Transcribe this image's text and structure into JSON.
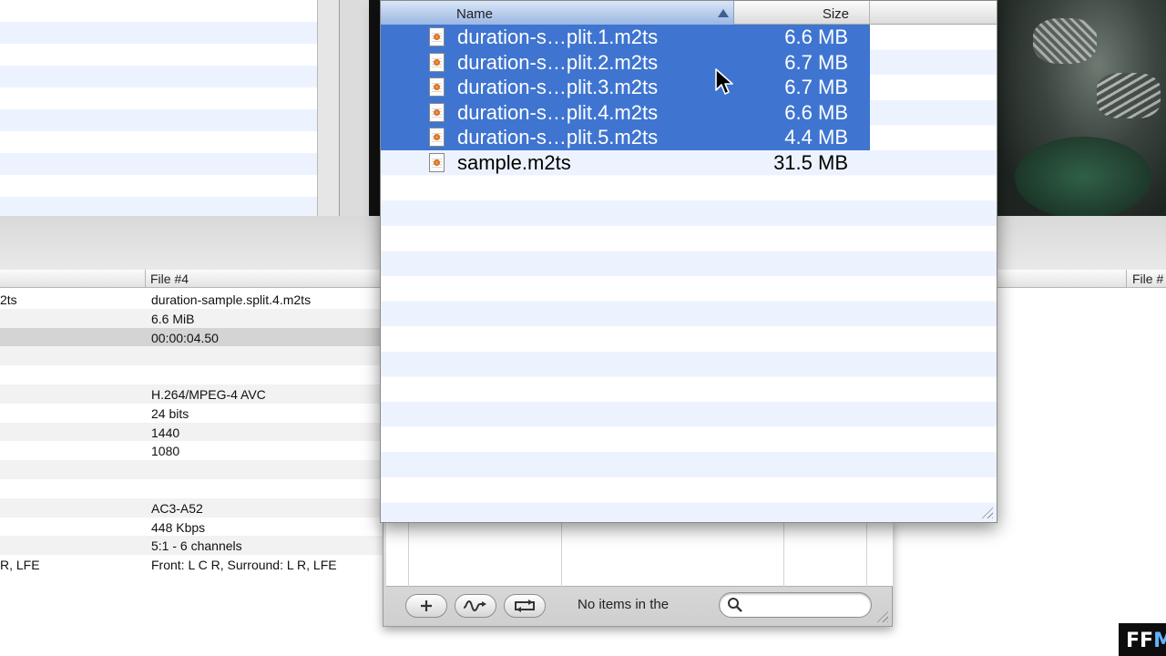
{
  "file_window": {
    "columns": {
      "name": "Name",
      "size": "Size"
    },
    "sort": "ascending",
    "files": [
      {
        "name": "duration-s…plit.1.m2ts",
        "size": "6.6 MB",
        "selected": true
      },
      {
        "name": "duration-s…plit.2.m2ts",
        "size": "6.7 MB",
        "selected": true
      },
      {
        "name": "duration-s…plit.3.m2ts",
        "size": "6.7 MB",
        "selected": true
      },
      {
        "name": "duration-s…plit.4.m2ts",
        "size": "6.6 MB",
        "selected": true
      },
      {
        "name": "duration-s…plit.5.m2ts",
        "size": "4.4 MB",
        "selected": true
      },
      {
        "name": "sample.m2ts",
        "size": "31.5 MB",
        "selected": false
      }
    ],
    "selection_color": "#3f75d0"
  },
  "info_table": {
    "column_header": "File #4",
    "right_column_header": "File #",
    "rows": [
      {
        "left": "2ts",
        "value": "duration-sample.split.4.m2ts"
      },
      {
        "left": "",
        "value": "6.6 MiB"
      },
      {
        "left": "",
        "value": "00:00:04.50",
        "highlight": true
      },
      {
        "left": "",
        "value": ""
      },
      {
        "left": "",
        "value": ""
      },
      {
        "left": "",
        "value": "H.264/MPEG-4 AVC"
      },
      {
        "left": "",
        "value": "24 bits"
      },
      {
        "left": "",
        "value": "1440"
      },
      {
        "left": "",
        "value": "1080"
      },
      {
        "left": "",
        "value": ""
      },
      {
        "left": "",
        "value": ""
      },
      {
        "left": "",
        "value": "AC3-A52"
      },
      {
        "left": "",
        "value": "448 Kbps"
      },
      {
        "left": "",
        "value": "5:1 - 6 channels"
      },
      {
        "left": "R, LFE",
        "value": "Front: L C R, Surround: L R, LFE"
      }
    ]
  },
  "batch_panel": {
    "status": "No items in the",
    "search_placeholder": "",
    "buttons": [
      "add",
      "waveform-arrow",
      "repeat"
    ]
  },
  "watermark": {
    "text_a": "FF",
    "text_b": "M"
  }
}
